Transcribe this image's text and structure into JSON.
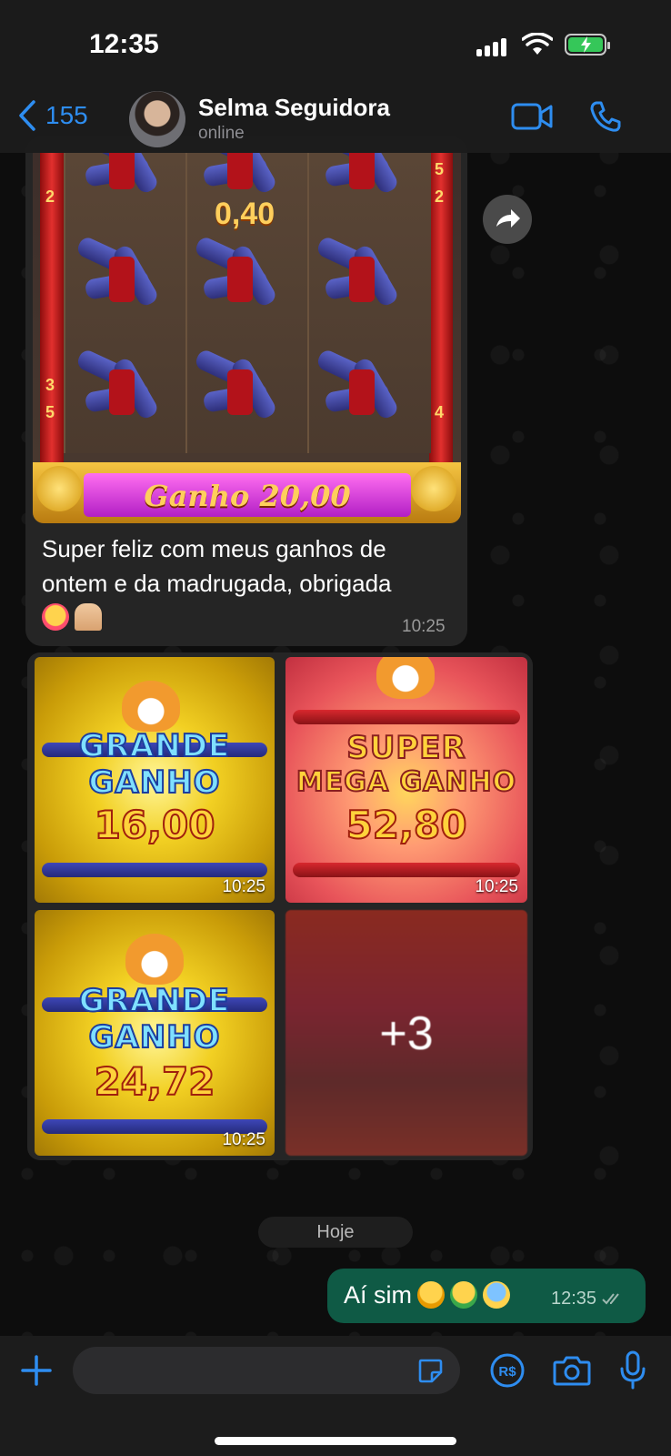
{
  "status_bar": {
    "time": "12:35"
  },
  "header": {
    "back_count": "155",
    "contact_name": "Selma Seguidora",
    "contact_status": "online",
    "icons": [
      "chevron-left-icon",
      "video-call-icon",
      "phone-icon"
    ]
  },
  "messages": {
    "slot_image": {
      "win_amount": "0,40",
      "reel_numbers_left": [
        "2",
        "3",
        "5"
      ],
      "reel_numbers_right": [
        "5",
        "2",
        "4"
      ],
      "banner_label": "Ganho",
      "banner_value": "20,00"
    },
    "caption": {
      "text": "Super feliz com meus ganhos de ontem e da madrugada, obrigada",
      "emojis": [
        "smiling-face-with-hearts",
        "folded-hands"
      ],
      "time": "10:25"
    },
    "album": {
      "tiles": [
        {
          "line1": "GRANDE",
          "line2": "GANHO",
          "amount": "16,00",
          "time": "10:25"
        },
        {
          "line1": "SUPER",
          "line2": "MEGA GANHO",
          "amount": "52,80",
          "time": "10:25"
        },
        {
          "line1": "GRANDE",
          "line2": "GANHO",
          "amount": "24,72",
          "time": "10:25"
        }
      ],
      "more_count": "+3"
    },
    "date_divider": "Hoje",
    "outgoing": {
      "text": "Aí sim",
      "emojis": [
        "star-struck",
        "money-mouth",
        "screaming-face"
      ],
      "time": "12:35"
    }
  },
  "colors": {
    "accent": "#2e8df0",
    "outgoing_bubble": "#0f5a45",
    "incoming_bubble": "#252525"
  }
}
